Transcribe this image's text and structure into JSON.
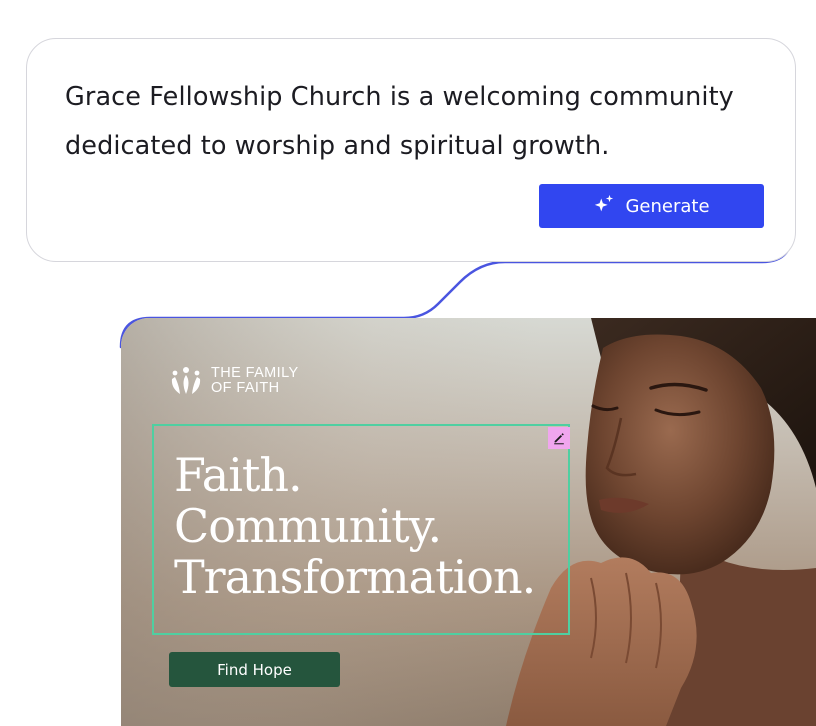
{
  "prompt": {
    "text": "Grace Fellowship Church is a welcoming community dedicated to worship and spiritual growth.",
    "generate_label": "Generate"
  },
  "preview": {
    "logo": {
      "line1": "THE FAMILY",
      "line2": "OF FAITH"
    },
    "headline": {
      "line1": "Faith.",
      "line2": "Community.",
      "line3": "Transformation."
    },
    "cta_label": "Find Hope"
  },
  "icons": {
    "generate": "sparkle-icon",
    "edit": "pencil-icon",
    "logo": "family-logo-icon"
  },
  "colors": {
    "accent": "#3146f0",
    "connector": "#4a55e0",
    "cta": "#25553d",
    "edit_frame": "#4fcfa1",
    "edit_badge": "#f0a6ee"
  }
}
